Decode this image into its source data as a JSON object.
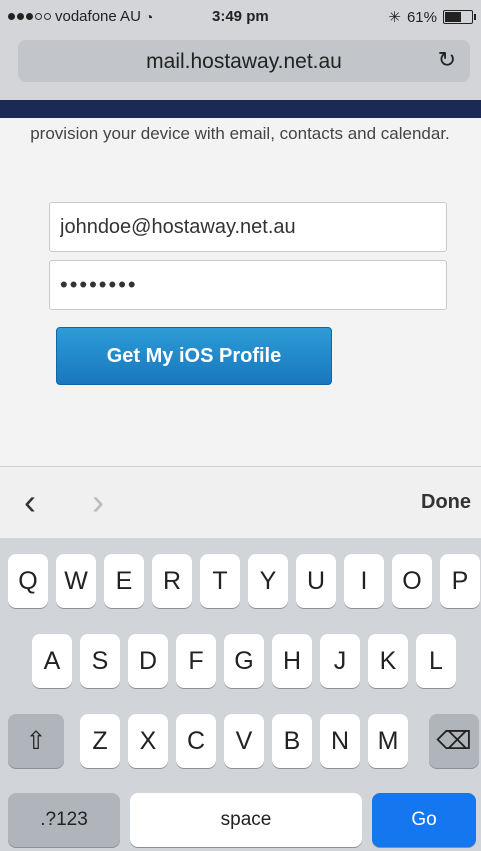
{
  "status": {
    "carrier": "vodafone AU",
    "time": "3:49 pm",
    "bluetooth": "✳",
    "battery": "61%",
    "battery_level": 0.61
  },
  "browser": {
    "url": "mail.hostaway.net.au",
    "reload_icon": "refresh-icon"
  },
  "page": {
    "intro": "provision your device with email, contacts and calendar.",
    "email_value": "johndoe@hostaway.net.au",
    "password_value": "••••••••",
    "button_label": "Get My iOS Profile"
  },
  "toolbar": {
    "prev_icon": "chevron-left-icon",
    "next_icon": "chevron-right-icon",
    "done_label": "Done"
  },
  "keyboard": {
    "row1": [
      "Q",
      "W",
      "E",
      "R",
      "T",
      "Y",
      "U",
      "I",
      "O",
      "P"
    ],
    "row2": [
      "A",
      "S",
      "D",
      "F",
      "G",
      "H",
      "J",
      "K",
      "L"
    ],
    "row3": [
      "Z",
      "X",
      "C",
      "V",
      "B",
      "N",
      "M"
    ],
    "numbers_label": ".?123",
    "space_label": "space",
    "go_label": "Go"
  },
  "colors": {
    "accent": "#1477f0",
    "button": "#1d82c6",
    "header_band": "#1b2a55"
  }
}
